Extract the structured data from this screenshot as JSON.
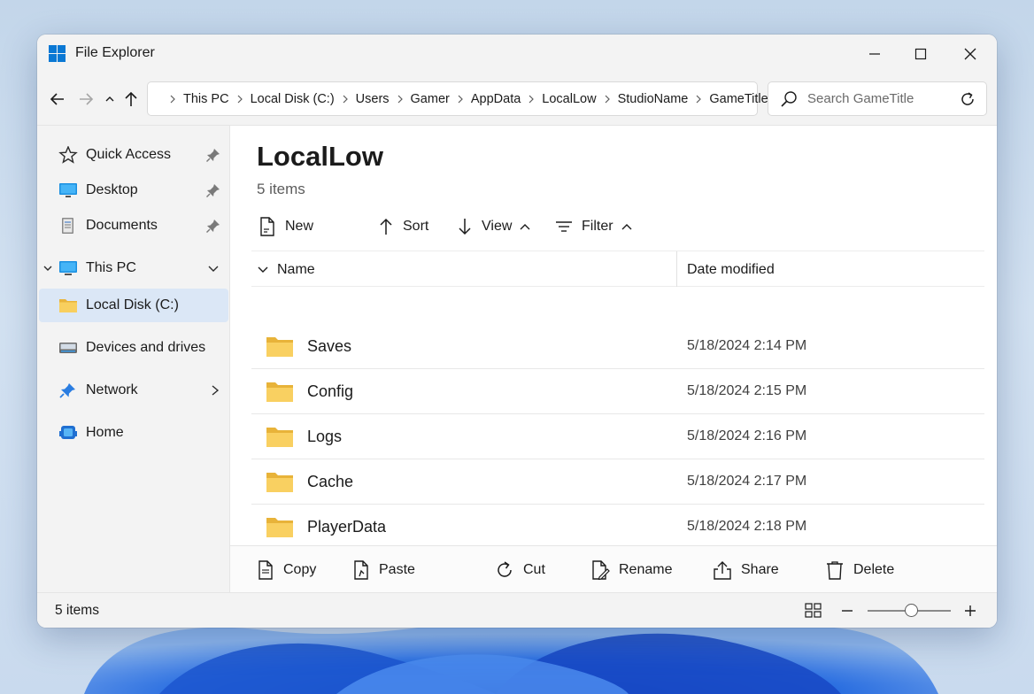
{
  "window": {
    "title": "File Explorer"
  },
  "address": {
    "crumbs": [
      "This PC",
      "Local Disk (C:)",
      "Users",
      "Gamer",
      "AppData",
      "LocalLow",
      "StudioName",
      "GameTitle"
    ]
  },
  "search": {
    "placeholder": "Search GameTitle"
  },
  "sidebar": {
    "items": [
      {
        "label": "Quick Access",
        "icon": "star-icon",
        "pinned": true
      },
      {
        "label": "Desktop",
        "icon": "desktop-icon",
        "pinned": true
      },
      {
        "label": "Documents",
        "icon": "documents-icon",
        "pinned": true
      },
      {
        "label": "This PC",
        "icon": "this-pc-icon",
        "expanded": true
      },
      {
        "label": "Local Disk (C:)",
        "icon": "folder-icon",
        "selected": true
      },
      {
        "label": "Devices and drives",
        "icon": "drive-icon"
      },
      {
        "label": "Network",
        "icon": "network-icon"
      },
      {
        "label": "Home",
        "icon": "home-icon"
      }
    ]
  },
  "main": {
    "title": "LocalLow",
    "count": "5 items",
    "commands": {
      "new": "New",
      "sort": "Sort",
      "view": "View",
      "filter": "Filter"
    },
    "columns": {
      "name": "Name",
      "date": "Date modified"
    },
    "rows": [
      {
        "name": "Saves",
        "date": "5/18/2024 2:14 PM"
      },
      {
        "name": "Config",
        "date": "5/18/2024 2:15 PM"
      },
      {
        "name": "Logs",
        "date": "5/18/2024 2:16 PM"
      },
      {
        "name": "Cache",
        "date": "5/18/2024 2:17 PM"
      },
      {
        "name": "PlayerData",
        "date": "5/18/2024 2:18 PM"
      }
    ],
    "actions": {
      "copy": "Copy",
      "paste": "Paste",
      "cut": "Cut",
      "rename": "Rename",
      "share": "Share",
      "delete": "Delete"
    }
  },
  "status": {
    "count": "5 items"
  },
  "colors": {
    "accent": "#0067c0",
    "folder": "#f6c64a",
    "selected": "#dbe7f6"
  }
}
